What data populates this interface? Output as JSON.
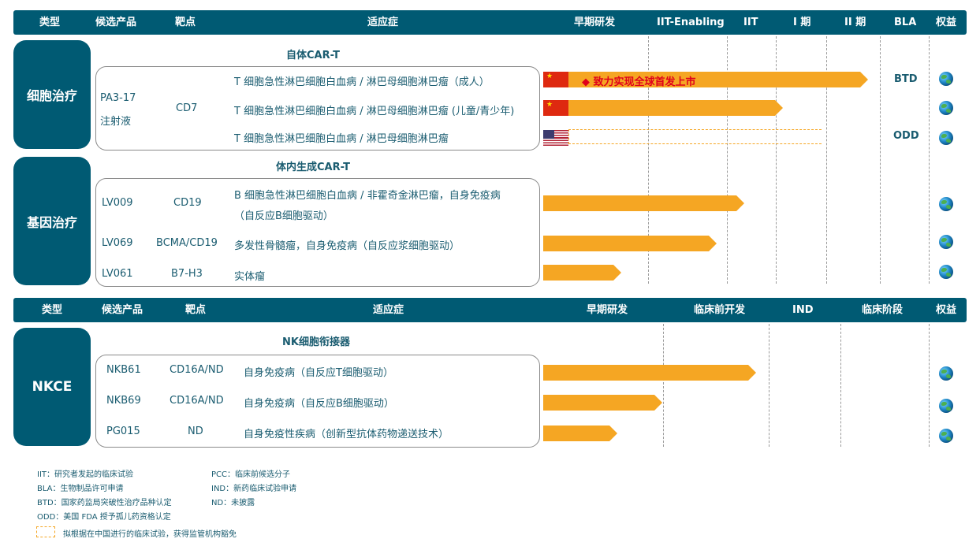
{
  "header1": {
    "type": "类型",
    "candidate": "候选产品",
    "target": "靶点",
    "indication": "适应症",
    "phases": [
      "早期研发",
      "IIT-Enabling",
      "IIT",
      "I 期",
      "II 期",
      "BLA"
    ],
    "rights": "权益"
  },
  "header2": {
    "type": "类型",
    "candidate": "候选产品",
    "target": "靶点",
    "indication": "适应症",
    "phases": [
      "早期研发",
      "临床前开发",
      "IND",
      "临床阶段"
    ],
    "rights": "权益"
  },
  "groups": [
    {
      "category": "细胞治疗",
      "subtitle": "自体CAR-T",
      "product": "PA3-17\n注射液",
      "product_line1": "PA3-17",
      "product_line2": "注射液",
      "target": "CD7",
      "rows": [
        {
          "indication": "T 细胞急性淋巴细胞白血病 / 淋巴母细胞淋巴瘤（成人）",
          "flag": "cn",
          "progress_phase": "II 期",
          "bar_note": "◆  致力实现全球首发上市",
          "status": "BTD",
          "rights_icon": "globe-icon"
        },
        {
          "indication": "T 细胞急性淋巴细胞白血病 / 淋巴母细胞淋巴瘤 (儿童/青少年)",
          "flag": "cn",
          "progress_phase": "IIT",
          "status": "",
          "rights_icon": "globe-icon"
        },
        {
          "indication": "T 细胞急性淋巴细胞白血病 / 淋巴母细胞淋巴瘤",
          "flag": "us",
          "progress_phase": "II 期",
          "planned": true,
          "status": "ODD",
          "rights_icon": "globe-icon"
        }
      ]
    },
    {
      "category": "基因治疗",
      "subtitle": "体内生成CAR-T",
      "rows": [
        {
          "product": "LV009",
          "target": "CD19",
          "indication": "B 细胞急性淋巴细胞白血病 / 非霍奇金淋巴瘤，自身免疫病",
          "indication2": "（自反应B细胞驱动）",
          "progress_phase": "IIT",
          "rights_icon": "globe-icon"
        },
        {
          "product": "LV069",
          "target": "BCMA/CD19",
          "indication": "多发性骨髓瘤，自身免疫病（自反应浆细胞驱动）",
          "progress_phase": "IIT-Enabling",
          "rights_icon": "globe-icon"
        },
        {
          "product": "LV061",
          "target": "B7-H3",
          "indication": "实体瘤",
          "progress_phase": "早期研发",
          "rights_icon": "globe-icon"
        }
      ]
    },
    {
      "category": "NKCE",
      "subtitle": "NK细胞衔接器",
      "rows": [
        {
          "product": "NKB61",
          "target": "CD16A/ND",
          "indication": "自身免疫病（自反应T细胞驱动）",
          "progress_phase": "临床前开发",
          "rights_icon": "globe-icon"
        },
        {
          "product": "NKB69",
          "target": "CD16A/ND",
          "indication": "自身免疫病（自反应B细胞驱动）",
          "progress_phase": "早期研发",
          "rights_icon": "globe-icon"
        },
        {
          "product": "PG015",
          "target": "ND",
          "indication": "自身免疫性疾病（创新型抗体药物递送技术）",
          "progress_phase": "早期研发",
          "rights_icon": "globe-icon"
        }
      ]
    }
  ],
  "footnotes": {
    "left": [
      "IIT：研究者发起的临床试验",
      "BLA：生物制品许可申请",
      "BTD：国家药监局突破性治疗品种认定",
      "ODD：美国 FDA 授予孤儿药资格认定"
    ],
    "right": [
      "PCC：临床前候选分子",
      "IND：新药临床试验申请",
      "ND：未披露"
    ],
    "legend": "拟根据在中国进行的临床试验，获得监管机构豁免"
  },
  "colors": {
    "header": "#005a73",
    "bar": "#f5a623",
    "text": "#1a5c70",
    "highlight": "#e0001b"
  }
}
